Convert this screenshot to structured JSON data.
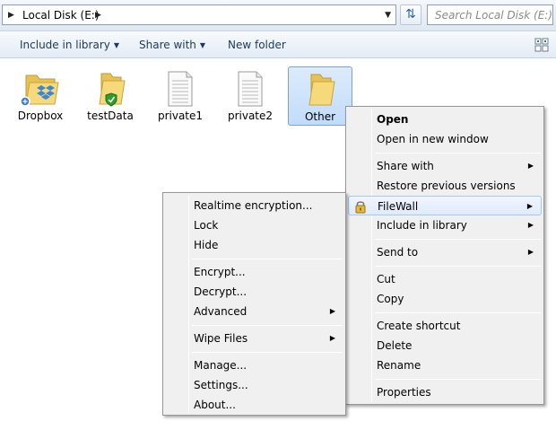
{
  "address_bar": {
    "path": "Local Disk (E:)",
    "search_placeholder": "Search Local Disk (E:)"
  },
  "command_bar": {
    "include_label": "Include in library",
    "share_label": "Share with",
    "new_folder_label": "New folder"
  },
  "items": [
    {
      "label": "Dropbox",
      "icon": "dropbox-folder-icon"
    },
    {
      "label": "testData",
      "icon": "shielded-folder-icon"
    },
    {
      "label": "private1",
      "icon": "document-icon"
    },
    {
      "label": "private2",
      "icon": "document-icon"
    },
    {
      "label": "Other",
      "icon": "folder-icon",
      "selected": true
    }
  ],
  "context_menu": {
    "open": "Open",
    "open_new_window": "Open in new window",
    "share_with": "Share with",
    "restore_previous": "Restore previous versions",
    "filewall": "FileWall",
    "include_in_library": "Include in library",
    "send_to": "Send to",
    "cut": "Cut",
    "copy": "Copy",
    "create_shortcut": "Create shortcut",
    "delete": "Delete",
    "rename": "Rename",
    "properties": "Properties"
  },
  "filewall_submenu": {
    "realtime_encryption": "Realtime encryption...",
    "lock": "Lock",
    "hide": "Hide",
    "encrypt": "Encrypt...",
    "decrypt": "Decrypt...",
    "advanced": "Advanced",
    "wipe_files": "Wipe Files",
    "manage": "Manage...",
    "settings": "Settings...",
    "about": "About..."
  },
  "colors": {
    "selection_fill": "#c1dcfc",
    "selection_border": "#7da2ce",
    "menu_background": "#f0f0f0",
    "menu_highlight": "#dfeafb",
    "command_text": "#1e395b",
    "folder_yellow": "#f3d36b"
  }
}
